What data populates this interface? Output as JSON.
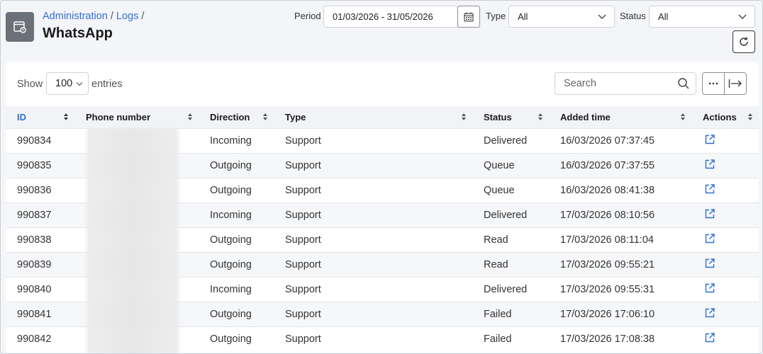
{
  "header": {
    "breadcrumb": [
      "Administration",
      "Logs"
    ],
    "title": "WhatsApp"
  },
  "filters": {
    "period_label": "Period",
    "period_value": "01/03/2026 - 31/05/2026",
    "type_label": "Type",
    "type_value": "All",
    "status_label": "Status",
    "status_value": "All"
  },
  "table_controls": {
    "show_label": "Show",
    "entries_value": "100",
    "entries_label": "entries",
    "search_placeholder": "Search"
  },
  "table": {
    "columns": [
      "ID",
      "Phone number",
      "Direction",
      "Type",
      "Status",
      "Added time",
      "Actions"
    ],
    "rows": [
      {
        "id": "990834",
        "phone": "",
        "direction": "Incoming",
        "type": "Support",
        "status": "Delivered",
        "added": "16/03/2026 07:37:45"
      },
      {
        "id": "990835",
        "phone": "",
        "direction": "Outgoing",
        "type": "Support",
        "status": "Queue",
        "added": "16/03/2026 07:37:55"
      },
      {
        "id": "990836",
        "phone": "",
        "direction": "Outgoing",
        "type": "Support",
        "status": "Queue",
        "added": "16/03/2026 08:41:38"
      },
      {
        "id": "990837",
        "phone": "",
        "direction": "Incoming",
        "type": "Support",
        "status": "Delivered",
        "added": "17/03/2026 08:10:56"
      },
      {
        "id": "990838",
        "phone": "",
        "direction": "Outgoing",
        "type": "Support",
        "status": "Read",
        "added": "17/03/2026 08:11:04"
      },
      {
        "id": "990839",
        "phone": "",
        "direction": "Outgoing",
        "type": "Support",
        "status": "Read",
        "added": "17/03/2026 09:55:21"
      },
      {
        "id": "990840",
        "phone": "",
        "direction": "Incoming",
        "type": "Support",
        "status": "Delivered",
        "added": "17/03/2026 09:55:31"
      },
      {
        "id": "990841",
        "phone": "",
        "direction": "Outgoing",
        "type": "Support",
        "status": "Failed",
        "added": "17/03/2026 17:06:10"
      },
      {
        "id": "990842",
        "phone": "",
        "direction": "Outgoing",
        "type": "Support",
        "status": "Failed",
        "added": "17/03/2026 17:08:38"
      }
    ]
  },
  "colors": {
    "accent": "#2f6fd6",
    "app_icon_bg": "#6b7079"
  },
  "icons": {
    "app": "log-window-icon",
    "calendar": "calendar-icon",
    "refresh": "refresh-icon",
    "search": "search-icon",
    "more": "more-horizontal-icon",
    "export": "export-icon",
    "row_action": "external-link-icon"
  }
}
